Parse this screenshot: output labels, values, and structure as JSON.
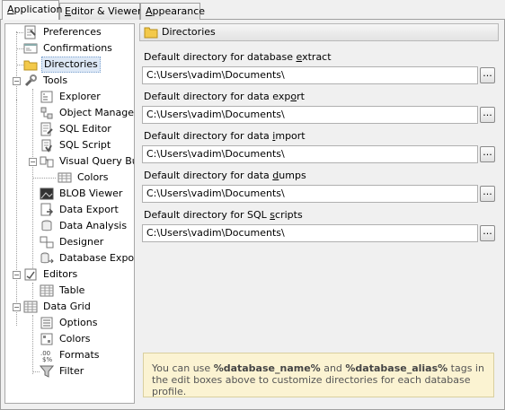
{
  "tabs": [
    {
      "pre": "",
      "u": "A",
      "post": "pplication"
    },
    {
      "pre": "",
      "u": "E",
      "post": "ditor & Viewers"
    },
    {
      "pre": "",
      "u": "A",
      "post": "ppearance"
    }
  ],
  "tree": {
    "preferences": "Preferences",
    "confirmations": "Confirmations",
    "directories": "Directories",
    "tools": "Tools",
    "explorer": "Explorer",
    "object_manager": "Object Manager",
    "sql_editor": "SQL Editor",
    "sql_script": "SQL Script",
    "vqb": "Visual Query Builder",
    "vqb_colors": "Colors",
    "blob_viewer": "BLOB Viewer",
    "data_export": "Data Export",
    "data_analysis": "Data Analysis",
    "designer": "Designer",
    "database_export": "Database Export",
    "editors": "Editors",
    "table": "Table",
    "data_grid": "Data Grid",
    "options": "Options",
    "grid_colors": "Colors",
    "formats": "Formats",
    "filter": "Filter"
  },
  "header": {
    "title": "Directories"
  },
  "fields": [
    {
      "label_pre": "Default directory for database ",
      "label_u": "e",
      "label_post": "xtract",
      "value": "C:\\Users\\vadim\\Documents\\",
      "button": "..."
    },
    {
      "label_pre": "Default directory for data exp",
      "label_u": "o",
      "label_post": "rt",
      "value": "C:\\Users\\vadim\\Documents\\",
      "button": "..."
    },
    {
      "label_pre": "Default directory for data ",
      "label_u": "i",
      "label_post": "mport",
      "value": "C:\\Users\\vadim\\Documents\\",
      "button": "..."
    },
    {
      "label_pre": "Default directory for data ",
      "label_u": "d",
      "label_post": "umps",
      "value": "C:\\Users\\vadim\\Documents\\",
      "button": "..."
    },
    {
      "label_pre": "Default directory for SQL ",
      "label_u": "s",
      "label_post": "cripts",
      "value": "C:\\Users\\vadim\\Documents\\",
      "button": "..."
    }
  ],
  "hint": {
    "t1": "You can use ",
    "b1": "%database_name%",
    "t2": " and ",
    "b2": "%database_alias%",
    "t3": " tags in the edit boxes above to customize directories for each database profile."
  },
  "colors": {
    "selection": "#dde8f6",
    "hint_bg": "#fbf3d2",
    "folder": "#f3c94a"
  }
}
